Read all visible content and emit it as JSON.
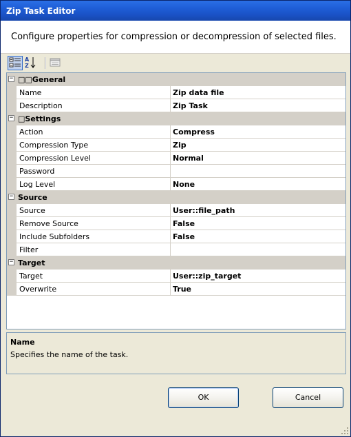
{
  "window": {
    "title": "Zip Task Editor"
  },
  "header": {
    "description": "Configure properties for compression or decompression of selected files."
  },
  "toolbar": {
    "buttons": [
      {
        "name": "categorized-view-button",
        "icon": "categorized-icon",
        "active": true
      },
      {
        "name": "alphabetical-sort-button",
        "icon": "sort-az-icon",
        "active": false
      },
      {
        "name": "property-pages-button",
        "icon": "property-pages-icon",
        "active": false
      }
    ]
  },
  "grid": {
    "categories": [
      {
        "label": "□□General",
        "toggle": "−",
        "properties": [
          {
            "name": "Name",
            "value": "Zip data file"
          },
          {
            "name": "Description",
            "value": "Zip Task"
          }
        ]
      },
      {
        "label": "□Settings",
        "toggle": "−",
        "properties": [
          {
            "name": "Action",
            "value": "Compress"
          },
          {
            "name": "Compression Type",
            "value": "Zip"
          },
          {
            "name": "Compression Level",
            "value": "Normal"
          },
          {
            "name": "Password",
            "value": ""
          },
          {
            "name": "Log Level",
            "value": "None"
          }
        ]
      },
      {
        "label": "Source",
        "toggle": "−",
        "properties": [
          {
            "name": "Source",
            "value": "User::file_path"
          },
          {
            "name": "Remove Source",
            "value": "False"
          },
          {
            "name": "Include Subfolders",
            "value": "False"
          },
          {
            "name": "Filter",
            "value": ""
          }
        ]
      },
      {
        "label": "Target",
        "toggle": "−",
        "properties": [
          {
            "name": "Target",
            "value": "User::zip_target"
          },
          {
            "name": "Overwrite",
            "value": "True"
          }
        ]
      }
    ]
  },
  "help": {
    "title": "Name",
    "text": "Specifies the name of the task."
  },
  "buttons": {
    "ok": "OK",
    "cancel": "Cancel"
  }
}
